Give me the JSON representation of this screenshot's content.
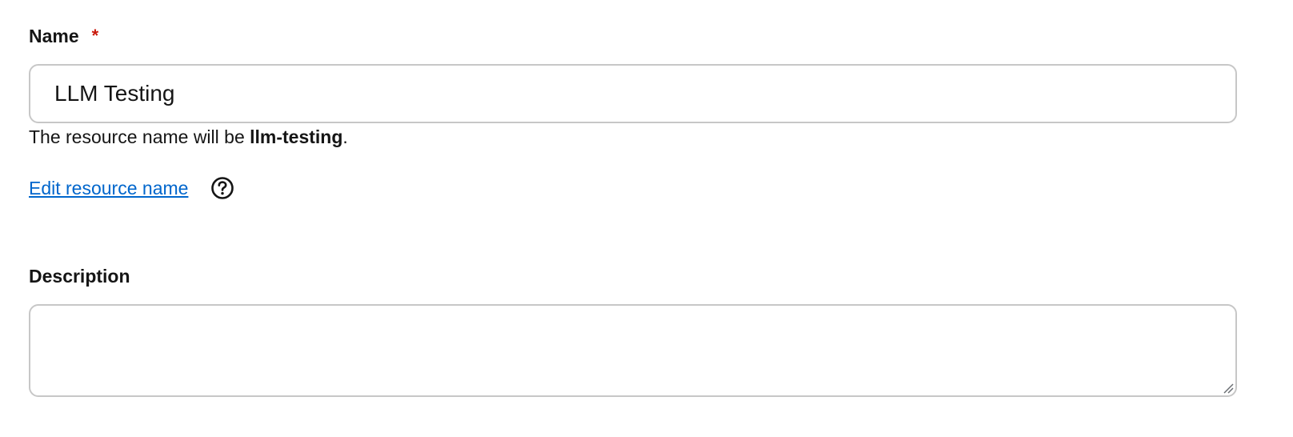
{
  "name_field": {
    "label": "Name",
    "required_marker": "*",
    "value": "LLM Testing",
    "placeholder": ""
  },
  "helper": {
    "prefix": "The resource name will be ",
    "resource_name": "llm-testing",
    "suffix": "."
  },
  "edit_link": {
    "label": "Edit resource name",
    "help_icon": "question-circle-icon"
  },
  "description_field": {
    "label": "Description",
    "value": "",
    "placeholder": ""
  },
  "colors": {
    "required": "#c9190b",
    "link": "#0066cc",
    "border": "#c7c7c7",
    "text": "#151515"
  }
}
